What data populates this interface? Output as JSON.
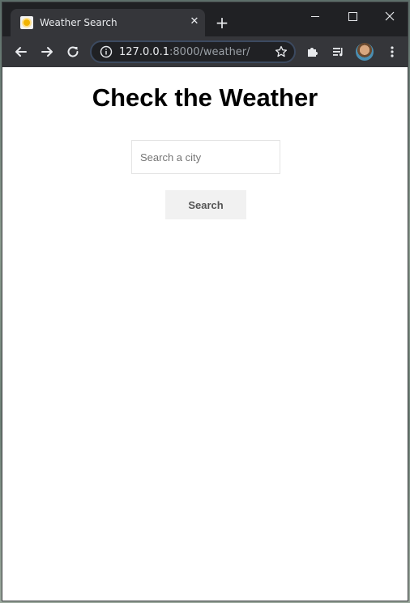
{
  "browser": {
    "tab_title": "Weather Search",
    "tab_close_glyph": "✕",
    "new_tab_glyph": "+",
    "url_host": "127.0.0.1",
    "url_path": ":8000/weather/"
  },
  "icons": {
    "favicon": "sun-icon",
    "back": "arrow-left-icon",
    "forward": "arrow-right-icon",
    "reload": "reload-icon",
    "site_info": "info-icon",
    "bookmark": "star-icon",
    "extensions": "puzzle-icon",
    "media": "media-queue-icon",
    "profile": "avatar",
    "menu": "kebab-menu-icon"
  },
  "page": {
    "heading": "Check the Weather",
    "search_placeholder": "Search a city",
    "search_value": "",
    "search_button_label": "Search"
  },
  "colors": {
    "tabstrip_bg": "#202124",
    "toolbar_bg": "#35363a",
    "button_bg": "#f1f1f1"
  }
}
